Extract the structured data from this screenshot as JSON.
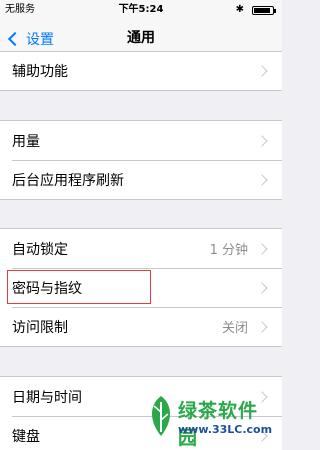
{
  "status_bar": {
    "carrier": "无服务",
    "time": "下午5:24",
    "battery_level": 0.9
  },
  "nav_bar": {
    "back_label": "设置",
    "title": "通用"
  },
  "groups": [
    {
      "items": [
        {
          "label": "辅助功能"
        }
      ]
    },
    {
      "items": [
        {
          "label": "用量"
        },
        {
          "label": "后台应用程序刷新"
        }
      ]
    },
    {
      "items": [
        {
          "label": "自动锁定",
          "value": "1 分钟"
        },
        {
          "label": "密码与指纹"
        },
        {
          "label": "访问限制",
          "value": "关闭"
        }
      ]
    },
    {
      "items": [
        {
          "label": "日期与时间"
        },
        {
          "label": "键盘"
        }
      ]
    }
  ],
  "watermark": {
    "text": "绿茶软件园",
    "url": "www.33LC.com"
  },
  "colors": {
    "accent": "#007aff",
    "highlight": "#e83a3a",
    "watermark_green": "#2aa84a"
  }
}
